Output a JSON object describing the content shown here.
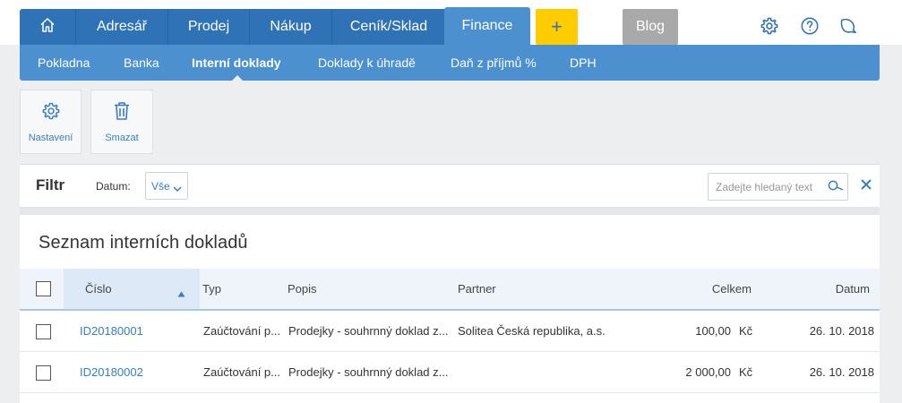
{
  "nav": {
    "home_icon": "home-icon",
    "items": [
      "Adresář",
      "Prodej",
      "Nákup",
      "Ceník/Sklad"
    ],
    "active": "Finance",
    "plus": "+",
    "blog": "Blog",
    "right_icons": [
      "gear-icon",
      "help-icon",
      "bulb-icon"
    ]
  },
  "subnav": {
    "items": [
      "Pokladna",
      "Banka",
      "Interní doklady",
      "Doklady k úhradě",
      "Daň z příjmů %",
      "DPH"
    ],
    "active_index": 2
  },
  "toolbar": {
    "settings_label": "Nastavení",
    "delete_label": "Smazat"
  },
  "filter": {
    "title": "Filtr",
    "datum_label": "Datum:",
    "datum_value": "Vše",
    "search_placeholder": "Zadejte hledaný text"
  },
  "list": {
    "title": "Seznam interních dokladů",
    "columns": [
      "Číslo",
      "Typ",
      "Popis",
      "Partner",
      "Celkem",
      "Datum"
    ],
    "sorted_column": "Číslo",
    "sort_direction": "ascending",
    "rows": [
      {
        "cislo": "ID20180001",
        "typ": "Zaúčtování p...",
        "popis": "Prodejky - souhrnný doklad z...",
        "partner": "Solitea Česká republika, a.s.",
        "celkem": "100,00",
        "mena": "Kč",
        "datum": "26. 10. 2018"
      },
      {
        "cislo": "ID20180002",
        "typ": "Zaúčtování p...",
        "popis": "Prodejky - souhrnný doklad z...",
        "partner": "",
        "celkem": "2 000,00",
        "mena": "Kč",
        "datum": "26. 10. 2018"
      }
    ]
  },
  "colors": {
    "nav_dark": "#2f73b6",
    "nav_light": "#4d90d0",
    "accent_yellow": "#ffcc00",
    "blog_grey": "#a9a9a9",
    "link_blue": "#3a7cc0"
  }
}
